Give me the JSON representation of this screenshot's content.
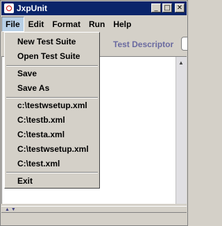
{
  "window": {
    "title": "JxpUnit",
    "controls": {
      "minimize": "_",
      "maximize": "□",
      "close": "✕"
    }
  },
  "menubar": {
    "items": [
      {
        "label": "File"
      },
      {
        "label": "Edit"
      },
      {
        "label": "Format"
      },
      {
        "label": "Run"
      },
      {
        "label": "Help"
      }
    ]
  },
  "toolbar": {
    "test_descriptor_label": "Test Descriptor"
  },
  "file_menu": {
    "new_test_suite": "New Test Suite",
    "open_test_suite": "Open Test Suite",
    "save": "Save",
    "save_as": "Save As",
    "recent": [
      "c:\\testwsetup.xml",
      "C:\\testb.xml",
      "C:\\testa.xml",
      "C:\\testwsetup.xml",
      "C:\\test.xml"
    ],
    "exit": "Exit"
  }
}
